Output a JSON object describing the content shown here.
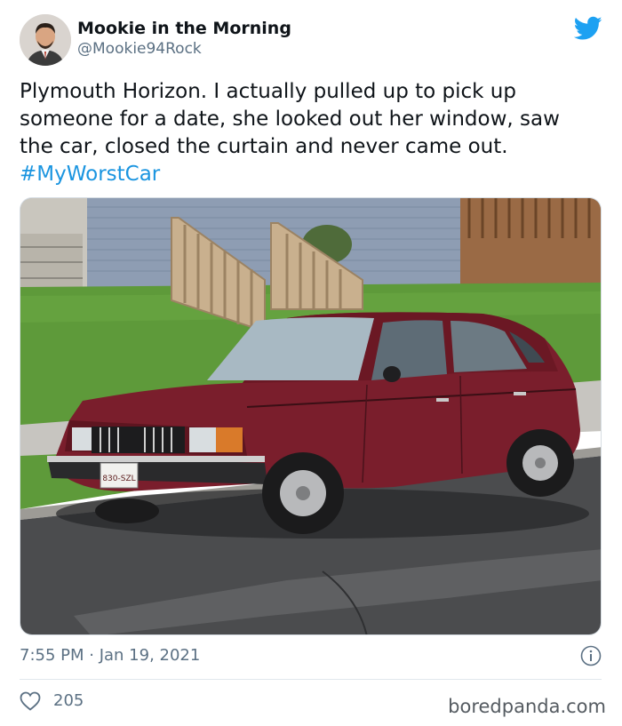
{
  "author": {
    "name": "Mookie in the Morning",
    "handle": "@Mookie94Rock"
  },
  "tweet": {
    "lines": [
      "Plymouth Horizon. I actually pulled up to pick up",
      "someone for a date, she looked out her window, saw",
      "the car, closed the curtain and never came out."
    ],
    "hashtag": "#MyWorstCar"
  },
  "photo": {
    "plate_text": "830-SZL"
  },
  "meta": {
    "timestamp": "7:55 PM · Jan 19, 2021",
    "likes": "205"
  },
  "watermark": "boredpanda.com",
  "icons": {
    "brand": "twitter-bird-icon",
    "info": "info-icon",
    "like": "heart-icon"
  },
  "colors": {
    "accent": "#1da1f2",
    "hashtag": "#1b95e0",
    "secondary_text": "#5b7083",
    "car": "#7a1e2c"
  }
}
